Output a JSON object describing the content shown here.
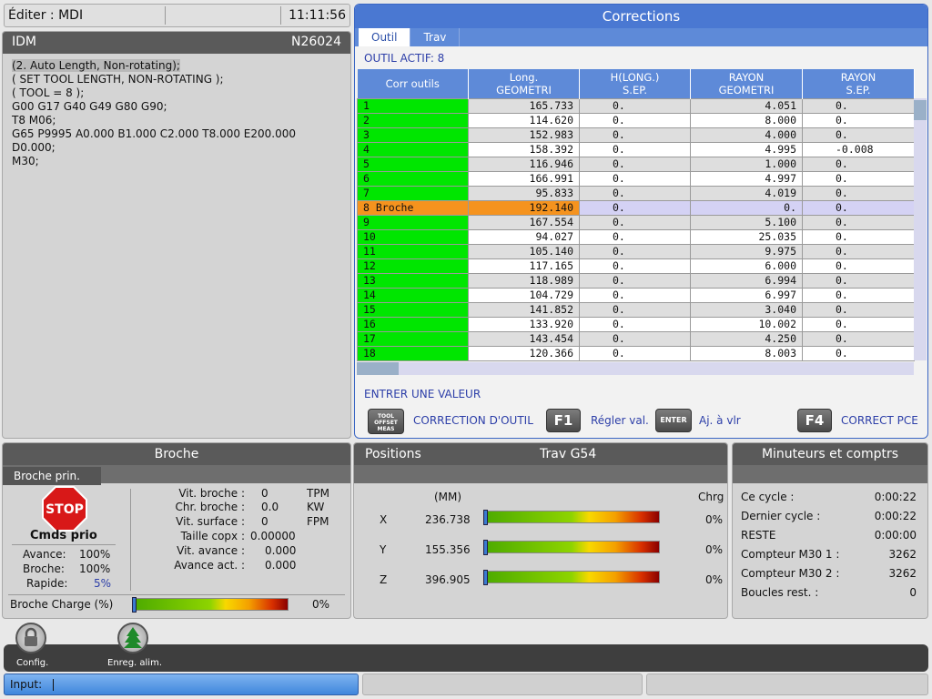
{
  "topbar": {
    "mode": "Éditer : MDI",
    "clock": "11:11:56"
  },
  "program": {
    "title": "IDM",
    "number": "N26024",
    "lines": [
      "(2. Auto Length, Non-rotating);",
      "( SET TOOL LENGTH, NON-ROTATING );",
      "( TOOL = 8 );",
      "G00 G17 G40 G49 G80 G90;",
      "T8 M06;",
      "G65 P9995 A0.000 B1.000 C2.000 T8.000 E200.000",
      "D0.000;",
      "M30;"
    ]
  },
  "corrections": {
    "title": "Corrections",
    "tabs": [
      "Outil",
      "Trav"
    ],
    "active_tool_label": "OUTIL ACTIF: 8",
    "columns": [
      "Corr outils",
      "Long.\nGEOMETRI",
      "H(LONG.)\nS.EP.",
      "RAYON\nGEOMETRI",
      "RAYON\nS.EP."
    ],
    "rows": [
      [
        "1",
        "165.733",
        "0.",
        "4.051",
        "0."
      ],
      [
        "2",
        "114.620",
        "0.",
        "8.000",
        "0."
      ],
      [
        "3",
        "152.983",
        "0.",
        "4.000",
        "0."
      ],
      [
        "4",
        "158.392",
        "0.",
        "4.995",
        "-0.008"
      ],
      [
        "5",
        "116.946",
        "0.",
        "1.000",
        "0."
      ],
      [
        "6",
        "166.991",
        "0.",
        "4.997",
        "0."
      ],
      [
        "7",
        "95.833",
        "0.",
        "4.019",
        "0."
      ],
      [
        "8 Broche",
        "192.140",
        "0.",
        "0.",
        "0."
      ],
      [
        "9",
        "167.554",
        "0.",
        "5.100",
        "0."
      ],
      [
        "10",
        "94.027",
        "0.",
        "25.035",
        "0."
      ],
      [
        "11",
        "105.140",
        "0.",
        "9.975",
        "0."
      ],
      [
        "12",
        "117.165",
        "0.",
        "6.000",
        "0."
      ],
      [
        "13",
        "118.989",
        "0.",
        "6.994",
        "0."
      ],
      [
        "14",
        "104.729",
        "0.",
        "6.997",
        "0."
      ],
      [
        "15",
        "141.852",
        "0.",
        "3.040",
        "0."
      ],
      [
        "16",
        "133.920",
        "0.",
        "10.002",
        "0."
      ],
      [
        "17",
        "143.454",
        "0.",
        "4.250",
        "0."
      ],
      [
        "18",
        "120.366",
        "0.",
        "8.003",
        "0."
      ]
    ],
    "selected_row": 7,
    "prompt": "ENTRER UNE VALEUR",
    "keys": {
      "tool_offset_key": "TOOL\nOFFSET\nMEAS",
      "tool_offset_label": "CORRECTION D'OUTIL",
      "f1_key": "F1",
      "f1_label": "Régler val.",
      "enter_key": "ENTER",
      "enter_label": "Aj. à vlr",
      "f4_key": "F4",
      "f4_label": "CORRECT PCE"
    }
  },
  "broche": {
    "title": "Broche",
    "subtab": "Broche prin.",
    "stop_text": "STOP",
    "cmds_title": "Cmds prio",
    "overrides": [
      {
        "label": "Avance:",
        "value": "100%"
      },
      {
        "label": "Broche:",
        "value": "100%"
      },
      {
        "label": "Rapide:",
        "value": "5%"
      }
    ],
    "stats": [
      {
        "label": "Vit. broche :",
        "value": "0",
        "unit": "TPM"
      },
      {
        "label": "Chr. broche :",
        "value": "0.0",
        "unit": "KW"
      },
      {
        "label": "Vit. surface :",
        "value": "0",
        "unit": "FPM"
      },
      {
        "label": "Taille copx :",
        "value": "0.00000",
        "unit": ""
      },
      {
        "label": "Vit. avance :",
        "value": "0.000",
        "unit": ""
      },
      {
        "label": "Avance act. :",
        "value": "0.000",
        "unit": ""
      }
    ],
    "load_label": "Broche Charge (%)",
    "load_value": "0%"
  },
  "positions": {
    "title": "Positions",
    "subtitle": "Trav G54",
    "unit_header": "(MM)",
    "load_header": "Chrg",
    "axes": [
      {
        "axis": "X",
        "value": "236.738",
        "load": "0%"
      },
      {
        "axis": "Y",
        "value": "155.356",
        "load": "0%"
      },
      {
        "axis": "Z",
        "value": "396.905",
        "load": "0%"
      }
    ]
  },
  "timers": {
    "title": "Minuteurs et comptrs",
    "items": [
      {
        "label": "Ce cycle :",
        "value": "0:00:22"
      },
      {
        "label": "Dernier cycle :",
        "value": "0:00:22"
      },
      {
        "label": "RESTE",
        "value": "0:00:00"
      },
      {
        "label": "Compteur M30 1 :",
        "value": "3262"
      },
      {
        "label": "Compteur M30 2 :",
        "value": "3262"
      },
      {
        "label": "Boucles rest. :",
        "value": "0"
      }
    ]
  },
  "toolbar": {
    "config_label": "Config.",
    "enreg_label": "Enreg. alim."
  },
  "input": {
    "label": "Input:"
  },
  "colors": {
    "accent": "#4a78d2",
    "selected_row": "#f5931e",
    "tool_cell": "#00e600",
    "link_text": "#2c3ea8"
  }
}
